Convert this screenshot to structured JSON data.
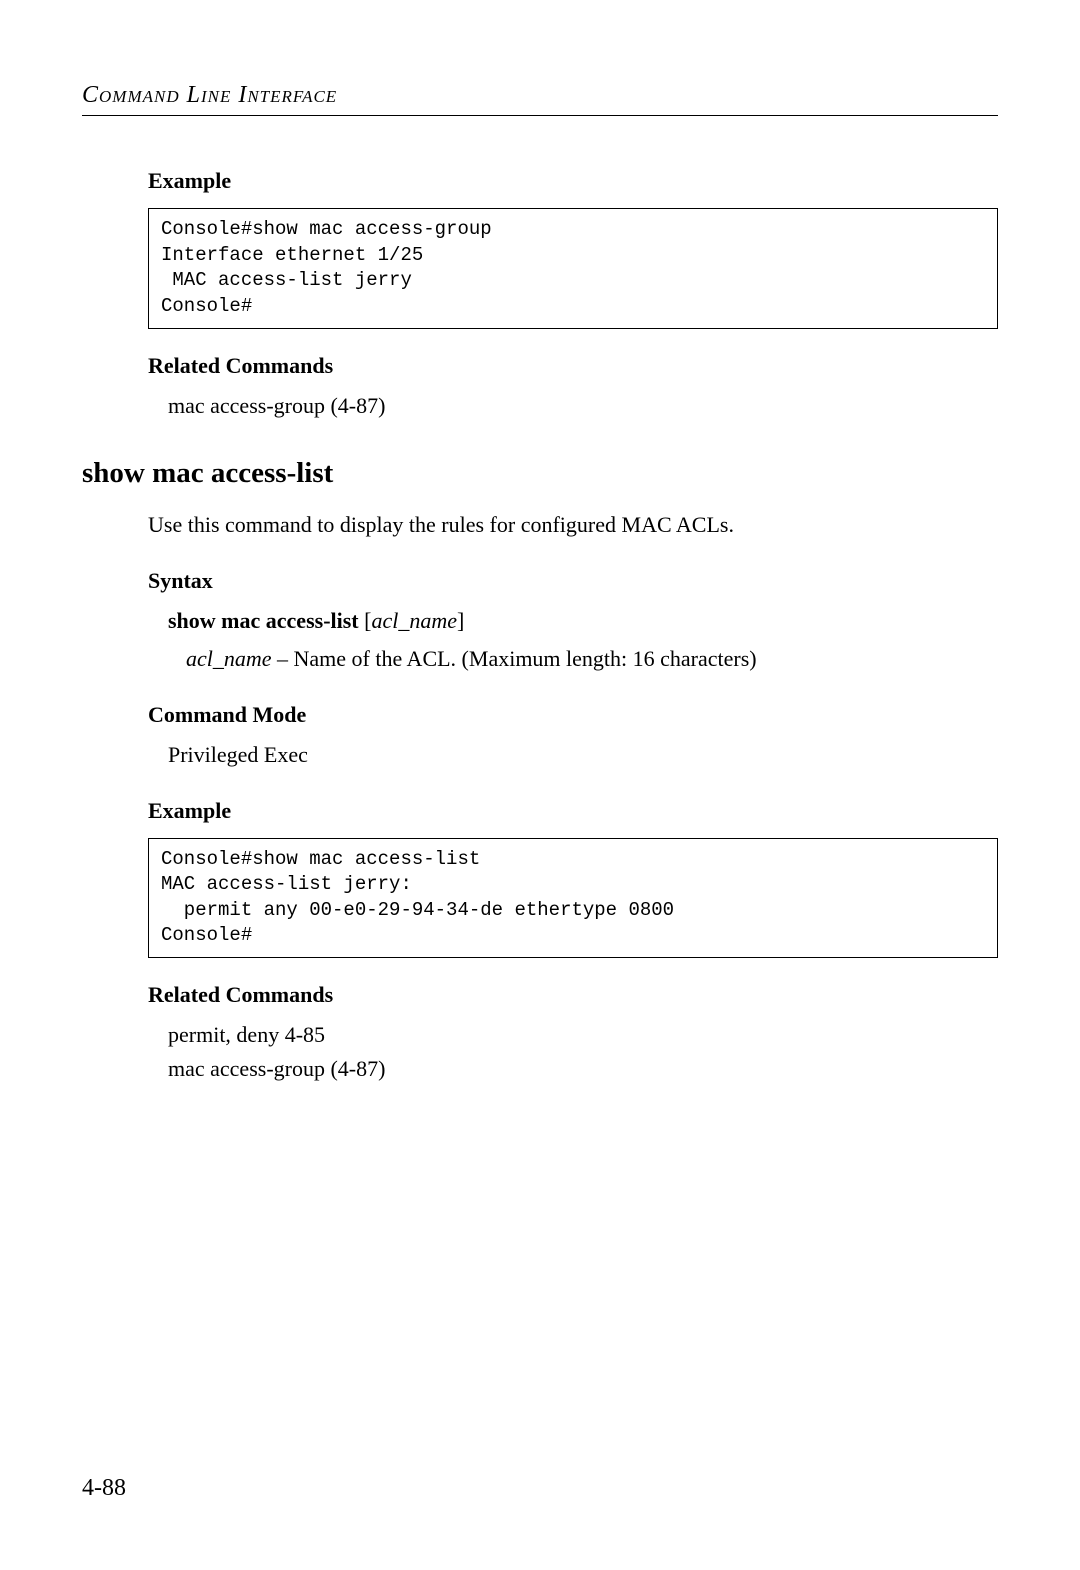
{
  "header": {
    "title": "Command Line Interface"
  },
  "sections": {
    "example1_label": "Example",
    "example1_code": "Console#show mac access-group\nInterface ethernet 1/25\n MAC access-list jerry\nConsole#",
    "related1_label": "Related Commands",
    "related1_item": "mac access-group (4-87)",
    "command_heading": "show mac access-list",
    "description": "Use this command to display the rules for configured MAC ACLs.",
    "syntax_label": "Syntax",
    "syntax_cmd": "show mac access-list",
    "syntax_bracket_open": " [",
    "syntax_param": "acl_name",
    "syntax_bracket_close": "]",
    "param_name": "acl_name",
    "param_desc": " – Name of the ACL. (Maximum length: 16 characters)",
    "mode_label": "Command Mode",
    "mode_value": "Privileged Exec",
    "example2_label": "Example",
    "example2_code": "Console#show mac access-list\nMAC access-list jerry:\n  permit any 00-e0-29-94-34-de ethertype 0800\nConsole#",
    "related2_label": "Related Commands",
    "related2_item1": "permit, deny 4-85",
    "related2_item2": "mac access-group (4-87)"
  },
  "page_number": "4-88"
}
